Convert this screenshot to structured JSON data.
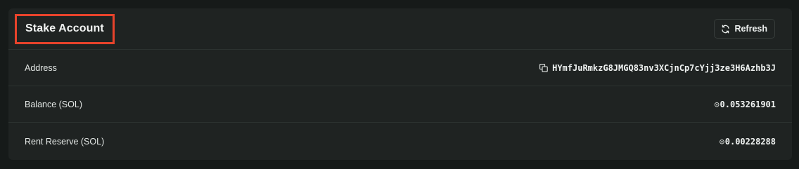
{
  "header": {
    "title": "Stake Account",
    "refresh_label": "Refresh",
    "title_highlight_color": "#e8432b"
  },
  "rows": [
    {
      "label": "Address",
      "value": "HYmfJuRmkzG8JMGQ83nv3XCjnCp7cYjj3ze3H6Azhb3J",
      "icon": "copy-icon"
    },
    {
      "label": "Balance (SOL)",
      "value": "0.053261901",
      "icon": "sol-icon",
      "prefix": "◎"
    },
    {
      "label": "Rent Reserve (SOL)",
      "value": "0.00228288",
      "icon": "sol-icon",
      "prefix": "◎"
    }
  ]
}
